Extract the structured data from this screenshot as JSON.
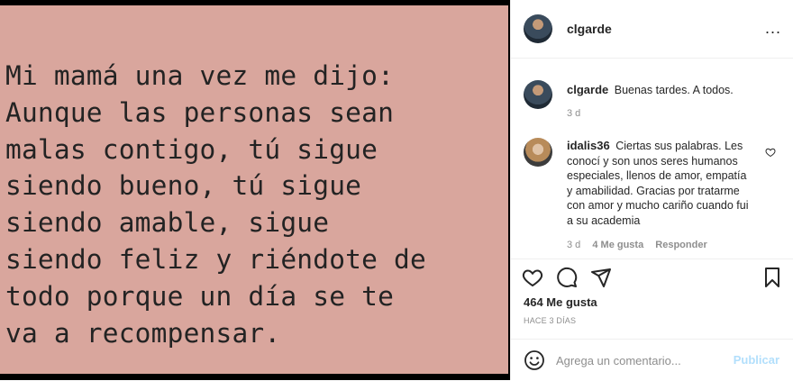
{
  "photo": {
    "lines": [
      "Mi mamá una vez me dijo:",
      "Aunque las personas sean",
      "malas contigo, tú sigue",
      "siendo bueno, tú sigue",
      "siendo amable, sigue",
      "siendo feliz y riéndote de",
      "todo porque un día se te",
      "va a recompensar."
    ]
  },
  "header": {
    "username": "clgarde",
    "more_icon": "..."
  },
  "comments": [
    {
      "username": "clgarde",
      "text": "Buenas tardes. A todos.",
      "time": "3 d"
    },
    {
      "username": "idalis36",
      "text": "Ciertas sus palabras. Les conocí y son unos seres humanos especiales, llenos de amor, empatía y amabilidad. Gracias por tratarme con amor y mucho cariño cuando fui a su academia",
      "time": "3 d",
      "likes": "4 Me gusta",
      "reply": "Responder"
    }
  ],
  "actions": {
    "likes": "464 Me gusta",
    "time_ago": "HACE 3 DÍAS",
    "icons": [
      "heart-icon",
      "comment-icon",
      "share-icon",
      "bookmark-icon"
    ]
  },
  "add_comment": {
    "placeholder": "Agrega un comentario...",
    "publish": "Publicar",
    "emoji_icon": "smiley-icon"
  }
}
